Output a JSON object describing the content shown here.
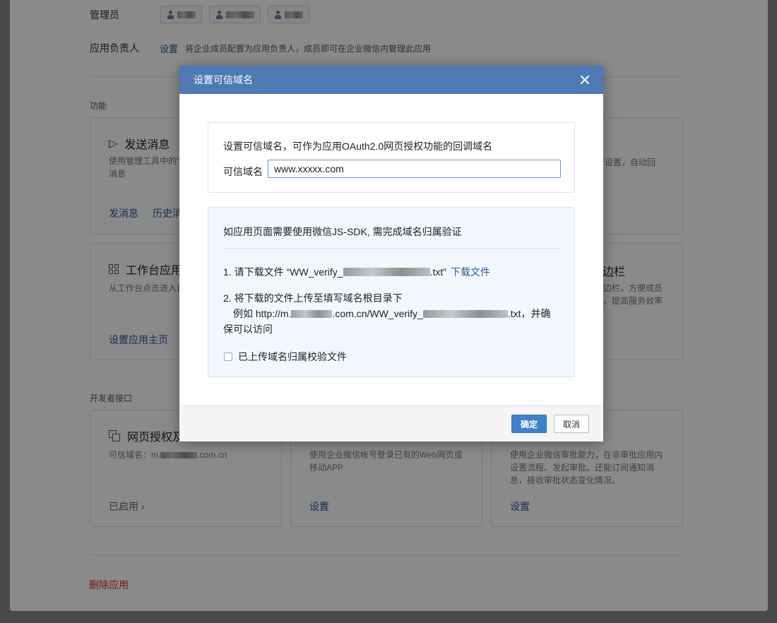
{
  "background": {
    "admins_label": "管理员",
    "owner_label": "应用负责人",
    "owner_set_link": "设置",
    "owner_desc": "将企业成员配置为应用负责人，成员即可在企业微信内管理此应用",
    "features_title": "功能",
    "card_send": {
      "title": "发送消息",
      "desc_line1": "使用管理工具中的“",
      "desc_line2": "消息",
      "action1": "发消息",
      "action2": "历史消"
    },
    "card_right_top": {
      "desc_line1": "设置，自动回"
    },
    "card_workbench": {
      "title": "工作台应用",
      "desc": "从工作台点击进入自",
      "action": "设置应用主页"
    },
    "card_sidebar": {
      "title": "边栏",
      "desc_line1": "边栏，方便成员",
      "desc_line2": "，提高服务效率"
    },
    "dev_title": "开发者接口",
    "card_web_auth": {
      "title": "网页授权及",
      "desc_prefix": "可信域名：m.",
      "desc_suffix": ".com.cn",
      "action": "已启用 ›"
    },
    "card_login": {
      "desc_line1": "使用企业微信帐号登录已有的Web网页或",
      "desc_line2": "移动APP",
      "action": "设置"
    },
    "card_approval": {
      "desc_line1": "使用企业微信审批能力，在非审批应用内",
      "desc_line2": "设置流程、发起审批。还能订阅通知消",
      "desc_line3": "息，接收审批状态变化情况。",
      "action": "设置"
    },
    "delete_app": "删除应用"
  },
  "dialog": {
    "title": "设置可信域名",
    "intro": "设置可信域名，可作为应用OAuth2.0网页授权功能的回调域名",
    "field_label": "可信域名",
    "field_value": "www.xxxxx.com",
    "verify_title": "如应用页面需要使用微信JS-SDK, 需完成域名归属验证",
    "step1_prefix": "1. 请下载文件 “WW_verify_",
    "step1_suffix": ".txt”",
    "step1_link": "下载文件",
    "step2_line1": "2. 将下载的文件上传至填写域名根目录下",
    "step2_example_prefix": "例如 http://m.",
    "step2_example_mid": ".com.cn/WW_verify_",
    "step2_example_suffix": ".txt，并确",
    "step2_line3": "保可以访问",
    "checkbox_label": "已上传域名归属校验文件",
    "ok_label": "确定",
    "cancel_label": "取消"
  }
}
